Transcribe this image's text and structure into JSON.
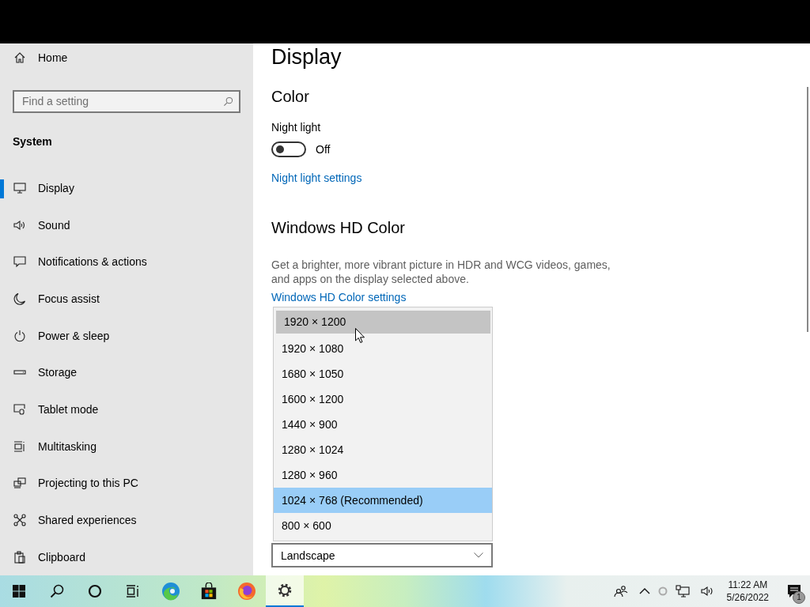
{
  "sidebar": {
    "home": "Home",
    "search": {
      "placeholder": "Find a setting"
    },
    "section": "System",
    "items": [
      {
        "label": "Display",
        "kind": "display",
        "selected": true
      },
      {
        "label": "Sound",
        "kind": "sound",
        "selected": false
      },
      {
        "label": "Notifications & actions",
        "kind": "notifications",
        "selected": false
      },
      {
        "label": "Focus assist",
        "kind": "moon",
        "selected": false
      },
      {
        "label": "Power & sleep",
        "kind": "power",
        "selected": false
      },
      {
        "label": "Storage",
        "kind": "storage",
        "selected": false
      },
      {
        "label": "Tablet mode",
        "kind": "tablet",
        "selected": false
      },
      {
        "label": "Multitasking",
        "kind": "multitasking",
        "selected": false
      },
      {
        "label": "Projecting to this PC",
        "kind": "projecting",
        "selected": false
      },
      {
        "label": "Shared experiences",
        "kind": "shared",
        "selected": false
      },
      {
        "label": "Clipboard",
        "kind": "clipboard",
        "selected": false
      }
    ]
  },
  "page": {
    "title": "Display",
    "color_heading": "Color",
    "night_light": {
      "label": "Night light",
      "on": false,
      "state_text": "Off",
      "link": "Night light settings"
    },
    "hd_heading": "Windows HD Color",
    "hd_description": "Get a brighter, more vibrant picture in HDR and WCG videos, games, and apps on the display selected above.",
    "hd_link": "Windows HD Color settings",
    "orientation_select": {
      "value": "Landscape"
    },
    "resolution_menu": [
      {
        "label": "1920 × 1200",
        "selected": false,
        "hovered": true
      },
      {
        "label": "1920 × 1080",
        "selected": false,
        "hovered": false
      },
      {
        "label": "1680 × 1050",
        "selected": false,
        "hovered": false
      },
      {
        "label": "1600 × 1200",
        "selected": false,
        "hovered": false
      },
      {
        "label": "1440 × 900",
        "selected": false,
        "hovered": false
      },
      {
        "label": "1280 × 1024",
        "selected": false,
        "hovered": false
      },
      {
        "label": "1280 × 960",
        "selected": false,
        "hovered": false
      },
      {
        "label": "1024 × 768 (Recommended)",
        "selected": true,
        "hovered": false
      },
      {
        "label": "800 × 600",
        "selected": false,
        "hovered": false
      }
    ]
  },
  "taskbar": {
    "apps": [
      {
        "kind": "start",
        "active": false
      },
      {
        "kind": "search",
        "active": false
      },
      {
        "kind": "cortana",
        "active": false
      },
      {
        "kind": "taskview",
        "active": false
      },
      {
        "kind": "edge",
        "active": false
      },
      {
        "kind": "store",
        "active": false
      },
      {
        "kind": "firefox",
        "active": false
      },
      {
        "kind": "settings",
        "active": true
      }
    ],
    "clock": {
      "time": "11:22 AM",
      "date": "5/26/2022"
    },
    "notification_count": "1"
  }
}
